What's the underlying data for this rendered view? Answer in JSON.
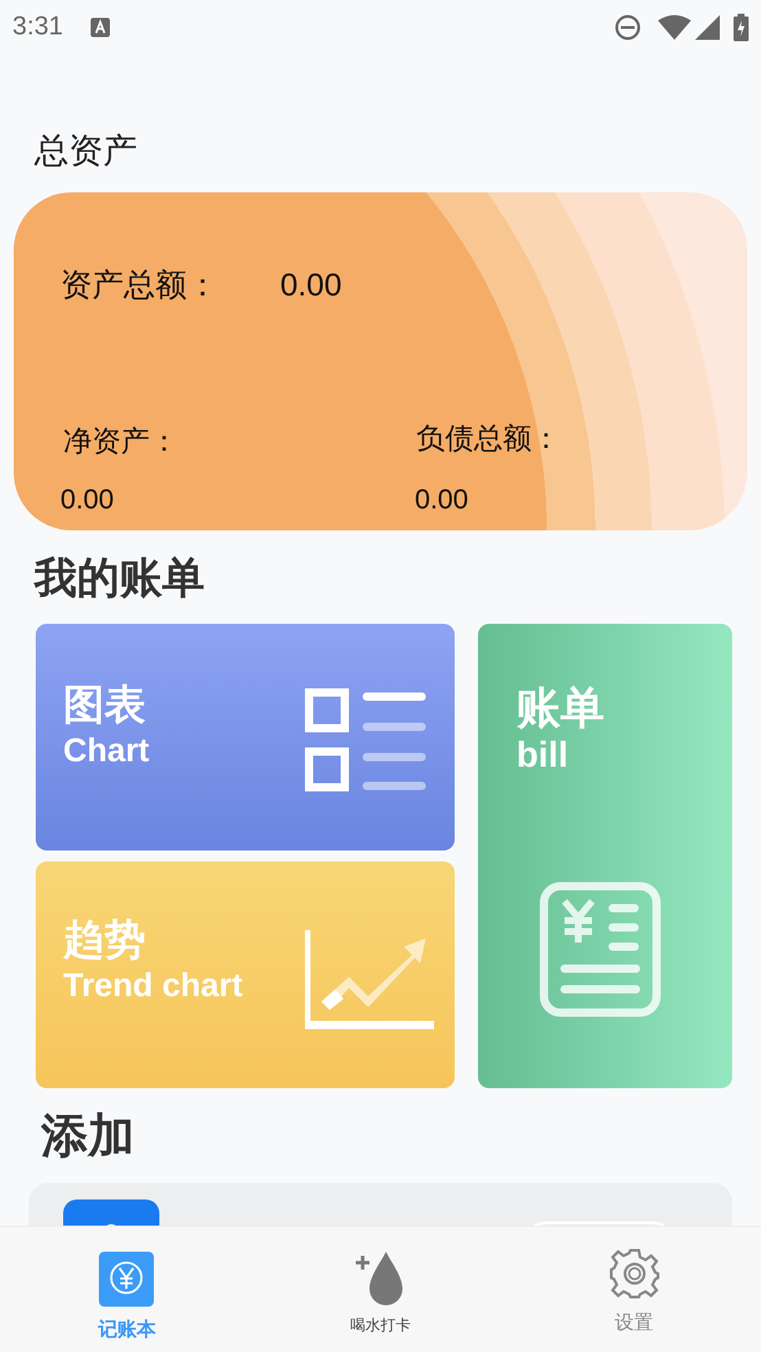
{
  "status_bar": {
    "time": "3:31"
  },
  "assets": {
    "title": "总资产",
    "total_label": "资产总额：",
    "total_value": "0.00",
    "net_label": "净资产：",
    "net_value": "0.00",
    "debt_label": "负债总额：",
    "debt_value": "0.00"
  },
  "bills": {
    "title": "我的账单",
    "tiles": [
      {
        "kind": "chart",
        "title": "图表",
        "subtitle": "Chart"
      },
      {
        "kind": "bill",
        "title": "账单",
        "subtitle": "bill"
      },
      {
        "kind": "trend",
        "title": "趋势",
        "subtitle": "Trend chart"
      }
    ]
  },
  "add": {
    "title": "添加"
  },
  "nav": {
    "items": [
      {
        "kind": "ledger",
        "label": "记账本",
        "selected": true
      },
      {
        "kind": "water",
        "label": "喝水打卡",
        "selected": false
      },
      {
        "kind": "settings",
        "label": "设置",
        "selected": false
      }
    ]
  }
}
